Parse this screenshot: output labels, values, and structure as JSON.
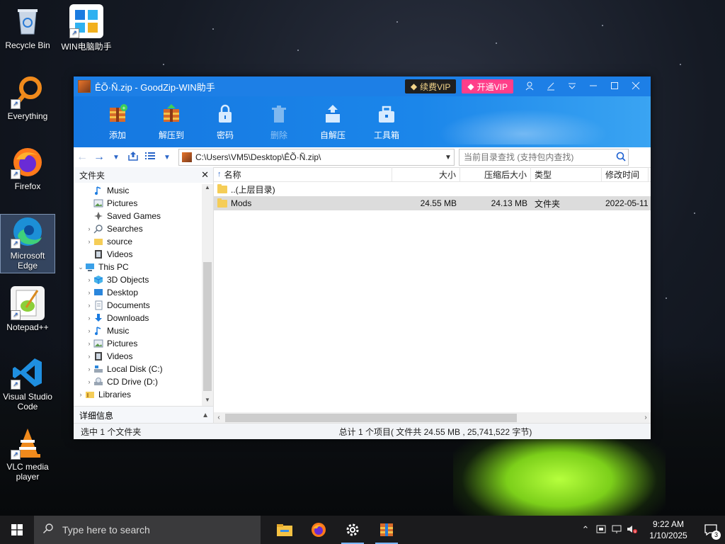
{
  "desktop": {
    "icons": [
      {
        "label": "Recycle Bin",
        "icon": "recycle-bin-icon"
      },
      {
        "label": "WIN电脑助手",
        "icon": "win-assistant-icon"
      },
      {
        "label": "Everything",
        "icon": "everything-icon"
      },
      {
        "label": "Firefox",
        "icon": "firefox-icon"
      },
      {
        "label": "Microsoft Edge",
        "icon": "edge-icon"
      },
      {
        "label": "Notepad++",
        "icon": "notepadpp-icon"
      },
      {
        "label": "Visual Studio Code",
        "icon": "vscode-icon"
      },
      {
        "label": "VLC media player",
        "icon": "vlc-icon"
      }
    ]
  },
  "window": {
    "title": "ÊÕ·Ñ.zip - GoodZip-WIN助手",
    "vip_renew": "续费VIP",
    "vip_open": "开通VIP",
    "accent": "#1d7fe6"
  },
  "toolbar": {
    "add": "添加",
    "extract_to": "解压到",
    "password": "密码",
    "delete": "删除",
    "self_extract": "自解压",
    "tools": "工具箱"
  },
  "address": {
    "path": "C:\\Users\\VM5\\Desktop\\ÊÕ·Ñ.zip\\",
    "search_placeholder": "当前目录查找 (支持包内查找)"
  },
  "left_pane": {
    "header": "文件夹",
    "details": "详细信息",
    "tree": [
      {
        "label": "Music",
        "icon": "music-icon"
      },
      {
        "label": "Pictures",
        "icon": "pictures-icon"
      },
      {
        "label": "Saved Games",
        "icon": "saved-games-icon"
      },
      {
        "label": "Searches",
        "icon": "searches-icon"
      },
      {
        "label": "source",
        "icon": "folder-icon"
      },
      {
        "label": "Videos",
        "icon": "videos-icon"
      },
      {
        "label": "This PC",
        "icon": "this-pc-icon"
      },
      {
        "label": "3D Objects",
        "icon": "3d-objects-icon"
      },
      {
        "label": "Desktop",
        "icon": "desktop-icon"
      },
      {
        "label": "Documents",
        "icon": "documents-icon"
      },
      {
        "label": "Downloads",
        "icon": "downloads-icon"
      },
      {
        "label": "Music",
        "icon": "music-icon"
      },
      {
        "label": "Pictures",
        "icon": "pictures-icon"
      },
      {
        "label": "Videos",
        "icon": "videos-icon"
      },
      {
        "label": "Local Disk (C:)",
        "icon": "local-disk-icon"
      },
      {
        "label": "CD Drive (D:)",
        "icon": "cd-drive-icon"
      },
      {
        "label": "Libraries",
        "icon": "libraries-icon"
      }
    ]
  },
  "file_list": {
    "columns": {
      "name": "名称",
      "size": "大小",
      "compressed": "压缩后大小",
      "type": "类型",
      "modified": "修改时间"
    },
    "rows": [
      {
        "name": "..(上层目录)",
        "size": "",
        "compressed": "",
        "type": "",
        "modified": ""
      },
      {
        "name": "Mods",
        "size": "24.55 MB",
        "compressed": "24.13 MB",
        "type": "文件夹",
        "modified": "2022-05-11"
      }
    ]
  },
  "status": {
    "left": "选中 1 个文件夹",
    "right": "总计 1 个项目( 文件共 24.55 MB , 25,741,522 字节)"
  },
  "taskbar": {
    "search_placeholder": "Type here to search",
    "time": "9:22 AM",
    "date": "1/10/2025",
    "notification_count": "3"
  }
}
